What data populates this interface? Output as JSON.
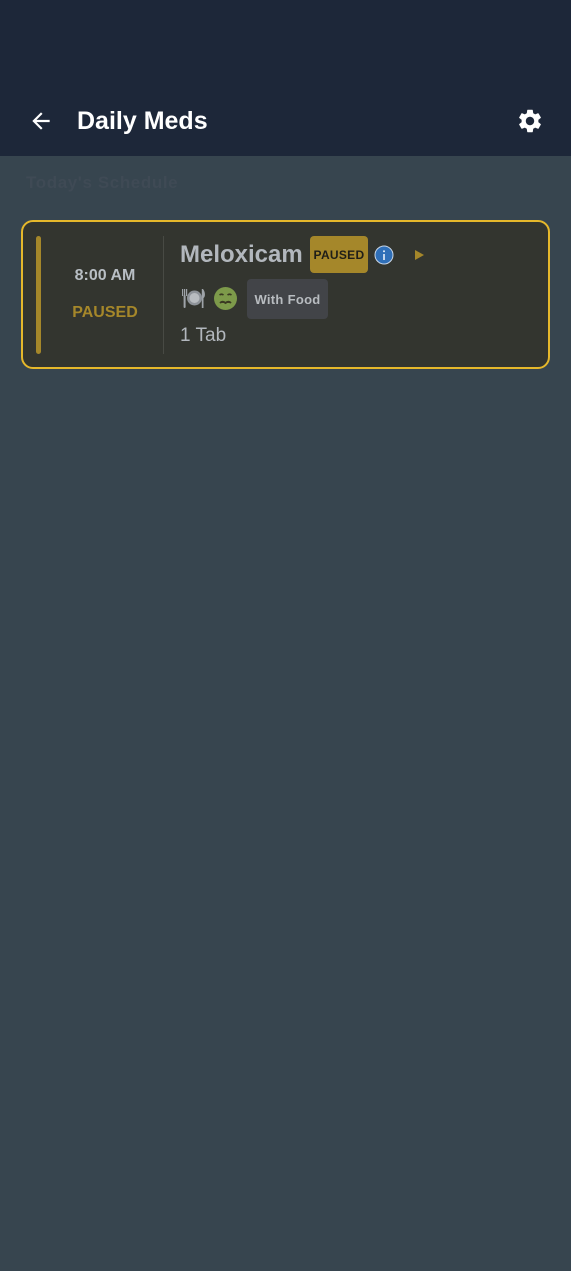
{
  "app_bar": {
    "title": "Daily Meds",
    "back_icon": "arrow-back-icon",
    "settings_icon": "gear-icon"
  },
  "schedule": {
    "heading": "Today's Schedule"
  },
  "medications": [
    {
      "time": "8:00 AM",
      "state": "PAUSED",
      "name": "Meloxicam",
      "badge": "PAUSED",
      "info_icon": "info-icon",
      "play_icon": "play-icon",
      "food_icon": "plate-cutlery-icon",
      "side_effect_icon": "nauseated-face-icon",
      "instruction": "With Food",
      "dose": "1 Tab"
    }
  ],
  "colors": {
    "header_bg": "#1d2739",
    "page_bg": "#37454f",
    "card_border": "#e6b82b",
    "paused_accent": "#a5872a",
    "card_bg": "#33352f"
  }
}
